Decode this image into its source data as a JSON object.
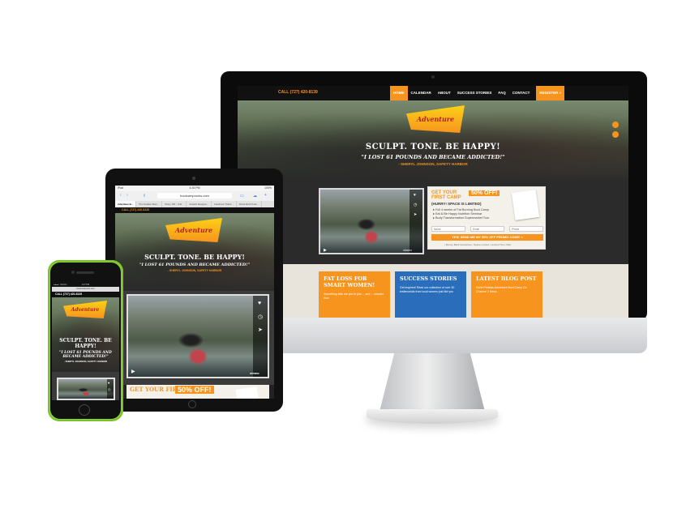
{
  "desktop": {
    "call": "CALL (727) 420-8139",
    "nav": [
      "HOME",
      "CALENDAR",
      "ABOUT",
      "SUCCESS STORIES",
      "FAQ",
      "CONTACT"
    ],
    "register": "REGISTER »",
    "logo_text": "Adventure",
    "tagline": "SCULPT. TONE. BE HAPPY!",
    "quote": "\"I LOST 61 POUNDS AND BECAME ADDICTED!\"",
    "attribution": "- SHERYL JOHNSON, SAFETY HARBOR",
    "offer": {
      "headline_1": "GET YOUR",
      "headline_2": "FIRST CAMP",
      "percent": "50% OFF!",
      "sub": "(HURRY! SPACE IS LIMITED)",
      "bullets": [
        "Full 4 weeks of Fat Burning Boot Camp",
        "Eat & Be Happy Nutrition Seminar",
        "Body Transformation Supermarket Tour"
      ],
      "fields": [
        "Name",
        "Email",
        "Phone"
      ],
      "cta": "YES! SEND ME MY 50% OFF PROMO CODE! »",
      "fine_print": "• Money Back Guarantee   • Space Limited   • Limited Time Offer"
    },
    "video_brand": "vimeo",
    "cards": [
      {
        "title": "FAT LOSS FOR SMART WOMEN!",
        "text": "Something tells me you're just ... and ... smarter than"
      },
      {
        "title": "SUCCESS STORIES",
        "text": "Get inspired! Read our collection of over 30 testimonials from local women just like you"
      },
      {
        "title": "LATEST BLOG POST",
        "text": "North Pinellas Adventure Boot Camp On Channel 2 News"
      }
    ],
    "colors": {
      "accent": "#f7941d",
      "blue": "#2a6ebb",
      "dark": "#111111"
    }
  },
  "tablet": {
    "status": "4:26 PM",
    "status_left": "iPad",
    "status_right": "100%",
    "url": "bootcamprocks.com",
    "tabs": [
      "Adventure B...",
      "The Creative Mom...",
      "Shop | MP - Grid...",
      "Graphic Designer...",
      "Facebook Twitter...",
      "Wood Work Tools..."
    ],
    "call": "CALL (727) 420-8139",
    "logo_text": "Adventure",
    "tagline": "SCULPT. TONE. BE HAPPY!",
    "quote": "\"I LOST 61 POUNDS AND BECAME ADDICTED!\"",
    "attribution": "- SHERYL JOHNSON, SAFETY HARBOR",
    "video_brand": "vimeo",
    "offer_headline_1": "GET YOUR",
    "offer_headline_2": "FIRST CAMP",
    "offer_percent": "50% OFF!"
  },
  "phone": {
    "status": "4:27 PM",
    "status_left": "●●●●○ Verizon",
    "url": "bootcamprocks.com",
    "call": "CALL (727) 420-8139",
    "logo_text": "Adventure",
    "tagline": "SCULPT. TONE. BE HAPPY!",
    "quote": "\"I LOST 61 POUNDS AND BECAME ADDICTED!\"",
    "attribution": "- SHERYL JOHNSON, SAFETY HARBOR",
    "device_color": "#8ed43a"
  },
  "icons": [
    "heart-icon",
    "clock-icon",
    "send-icon",
    "play-icon",
    "facebook-icon",
    "share-icon",
    "share-tray-icon",
    "bookmark-icon",
    "tabs-icon",
    "plus-icon"
  ]
}
